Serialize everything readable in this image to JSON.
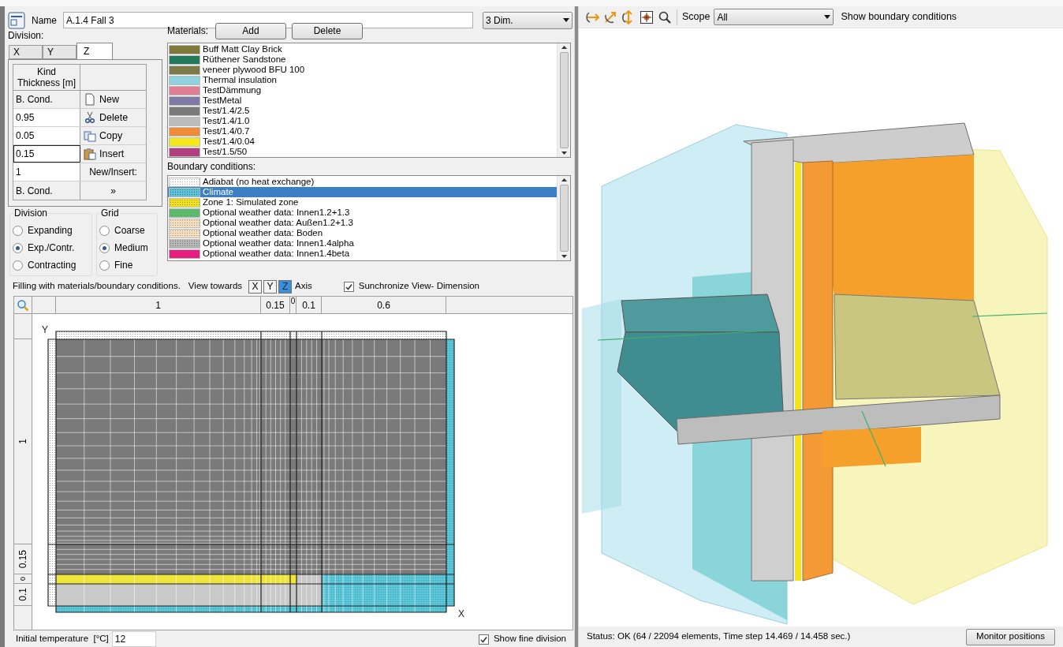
{
  "editor": {
    "name_label": "Name",
    "name_value": "A.1.4 Fall 3",
    "dimension": "3 Dim.",
    "division_label": "Division:",
    "axis_tabs": [
      {
        "label": "X",
        "selected": false
      },
      {
        "label": "Y",
        "selected": false
      },
      {
        "label": "Z",
        "selected": true
      }
    ],
    "layer_table": {
      "header": "Kind\nThickness [m]",
      "rows": [
        {
          "value": "B. Cond.",
          "kind": "label",
          "selected": false
        },
        {
          "value": "0.95",
          "kind": "field",
          "selected": false
        },
        {
          "value": "0.05",
          "kind": "field",
          "selected": false
        },
        {
          "value": "0.15",
          "kind": "field",
          "selected": true
        },
        {
          "value": "1",
          "kind": "field",
          "selected": false
        },
        {
          "value": "B. Cond.",
          "kind": "label",
          "selected": false
        }
      ],
      "actions": [
        {
          "label": "New",
          "kind": "new"
        },
        {
          "label": "Delete",
          "kind": "delete"
        },
        {
          "label": "Copy",
          "kind": "copy"
        },
        {
          "label": "Insert",
          "kind": "insert"
        },
        {
          "label": "New/Insert:",
          "kind": "text"
        },
        {
          "label": "»",
          "kind": "text"
        }
      ]
    },
    "division_group": {
      "title": "Division",
      "options": [
        {
          "label": "Expanding",
          "selected": false
        },
        {
          "label": "Exp./Contr.",
          "selected": true
        },
        {
          "label": "Contracting",
          "selected": false
        }
      ]
    },
    "grid_group": {
      "title": "Grid",
      "options": [
        {
          "label": "Coarse",
          "selected": false
        },
        {
          "label": "Medium",
          "selected": true
        },
        {
          "label": "Fine",
          "selected": false
        }
      ]
    },
    "materials": {
      "label": "Materials:",
      "buttons": [
        "Add",
        "Delete"
      ],
      "items": [
        {
          "name": "Buff Matt Clay Brick",
          "color": "#7f7a3a"
        },
        {
          "name": "Rüthener Sandstone",
          "color": "#217a5a"
        },
        {
          "name": "veneer plywood BFU 100",
          "color": "#7d7a48"
        },
        {
          "name": "Thermal insulation",
          "color": "#8fd3e0"
        },
        {
          "name": "TestDämmung",
          "color": "#e07f93"
        },
        {
          "name": "TestMetal",
          "color": "#7f7aa8"
        },
        {
          "name": "Test/1.4/2.5",
          "color": "#7a7a7a"
        },
        {
          "name": "Test/1.4/1.0",
          "color": "#bdbdbd"
        },
        {
          "name": "Test/1.4/0.7",
          "color": "#f08b3a"
        },
        {
          "name": "Test/1.4/0.04",
          "color": "#f5e81a"
        },
        {
          "name": "Test/1.5/50",
          "color": "#b0407f"
        }
      ]
    },
    "boundary_conditions": {
      "label": "Boundary conditions:",
      "items": [
        {
          "name": "Adiabat (no heat exchange)",
          "color": "#ffffff",
          "hatched": true,
          "selected": false
        },
        {
          "name": "Climate",
          "color": "#5bc2d6",
          "hatched": true,
          "selected": true
        },
        {
          "name": "Zone 1: Simulated zone",
          "color": "#f0e020",
          "hatched": true,
          "selected": false
        },
        {
          "name": "Optional weather data: Innen1.2+1.3",
          "color": "#5cb86a",
          "hatched": false,
          "selected": false
        },
        {
          "name": "Optional weather data: Außen1.2+1.3",
          "color": "#f3dfc0",
          "hatched": true,
          "selected": false
        },
        {
          "name": "Optional weather data: Boden",
          "color": "#f3dfc0",
          "hatched": true,
          "selected": false
        },
        {
          "name": "Optional weather data: Innen1.4alpha",
          "color": "#b5b5b5",
          "hatched": true,
          "selected": false
        },
        {
          "name": "Optional weather data: Innen1.4beta",
          "color": "#e81e7e",
          "hatched": false,
          "selected": false
        }
      ]
    },
    "fill_bar": {
      "text": "Filling with materials/boundary conditions.",
      "view_label": "View towards",
      "axes": [
        {
          "label": "X",
          "selected": false
        },
        {
          "label": "Y",
          "selected": false
        },
        {
          "label": "Z",
          "selected": true
        }
      ],
      "axis_label": "Axis",
      "sync": {
        "label": "Sunchronize View- Dimension",
        "checked": true
      }
    },
    "grid_editor": {
      "columns": [
        "1",
        "0.15",
        "0",
        "0.1",
        "0.6"
      ],
      "rows": [
        "1",
        "0.15",
        "0",
        "0.1"
      ],
      "y_label": "Y",
      "x_label": "X"
    },
    "initial_temperature": {
      "label": "Initial temperature  [°C]",
      "value": "12"
    },
    "fine_division": {
      "label": "Show fine division",
      "checked": true
    }
  },
  "viewer": {
    "scope_label": "Scope",
    "scope_value": "All",
    "show_bc_label": "Show boundary conditions",
    "status": "Status: OK (64 / 22094 elements, Time step 14.469 / 14.458 sec.)",
    "monitor_button": "Monitor positions"
  }
}
